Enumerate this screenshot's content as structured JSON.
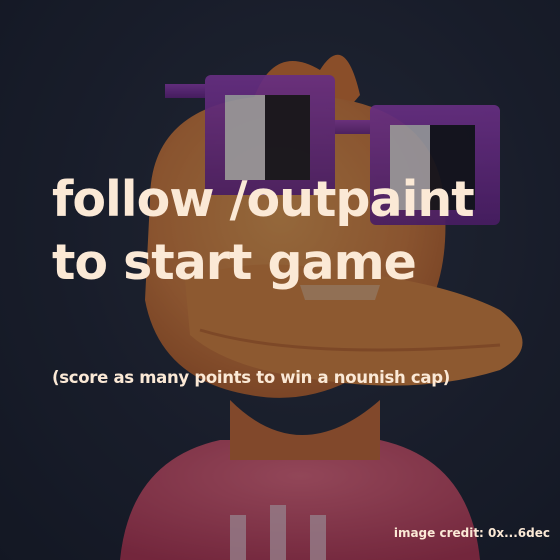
{
  "headline": {
    "line1": "follow /outpaint",
    "line2": "to start game"
  },
  "subline": "(score as many points to win a nounish cap)",
  "credit": "image credit: 0x...6dec",
  "colors": {
    "text": "#fbe9d6",
    "glasses": "#8a2fb0",
    "character_orange": "#e0823a",
    "shirt_pink": "#e0506a",
    "background": "#1e2330"
  }
}
